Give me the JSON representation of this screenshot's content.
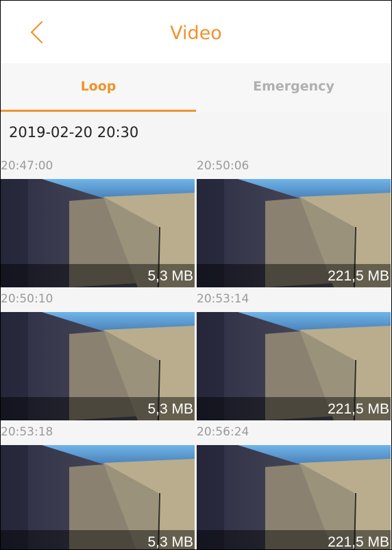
{
  "header": {
    "title": "Video",
    "back_icon": "chevron-left-icon"
  },
  "tabs": [
    {
      "label": "Loop",
      "active": true
    },
    {
      "label": "Emergency",
      "active": false
    }
  ],
  "colors": {
    "accent": "#f0922d",
    "inactive_tab": "#b0b0b0",
    "time_text": "#9a9a9a"
  },
  "group": {
    "date": "2019-02-20 20:30",
    "videos": [
      {
        "time": "20:47:00",
        "size": "5,3 MB"
      },
      {
        "time": "20:50:06",
        "size": "221,5 MB"
      },
      {
        "time": "20:50:10",
        "size": "5,3 MB"
      },
      {
        "time": "20:53:14",
        "size": "221,5 MB"
      },
      {
        "time": "20:53:18",
        "size": "5,3 MB"
      },
      {
        "time": "20:56:24",
        "size": "221,5 MB"
      }
    ]
  }
}
